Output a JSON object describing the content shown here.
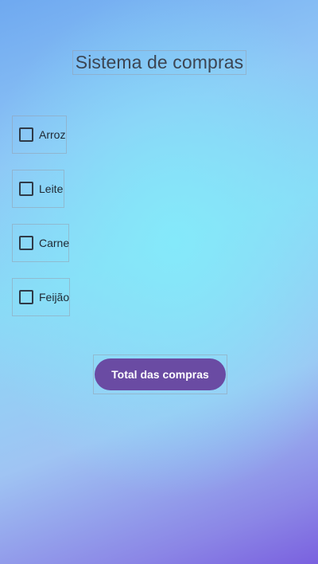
{
  "title": "Sistema de compras",
  "items": [
    {
      "label": "Arroz",
      "checked": false
    },
    {
      "label": "Leite",
      "checked": false
    },
    {
      "label": "Carne",
      "checked": false
    },
    {
      "label": "Feijão",
      "checked": false
    }
  ],
  "button": {
    "label": "Total das compras"
  },
  "colors": {
    "button": "#6a4ba3",
    "title_text": "#3c4552",
    "checkbox_border": "#2f3a48"
  }
}
